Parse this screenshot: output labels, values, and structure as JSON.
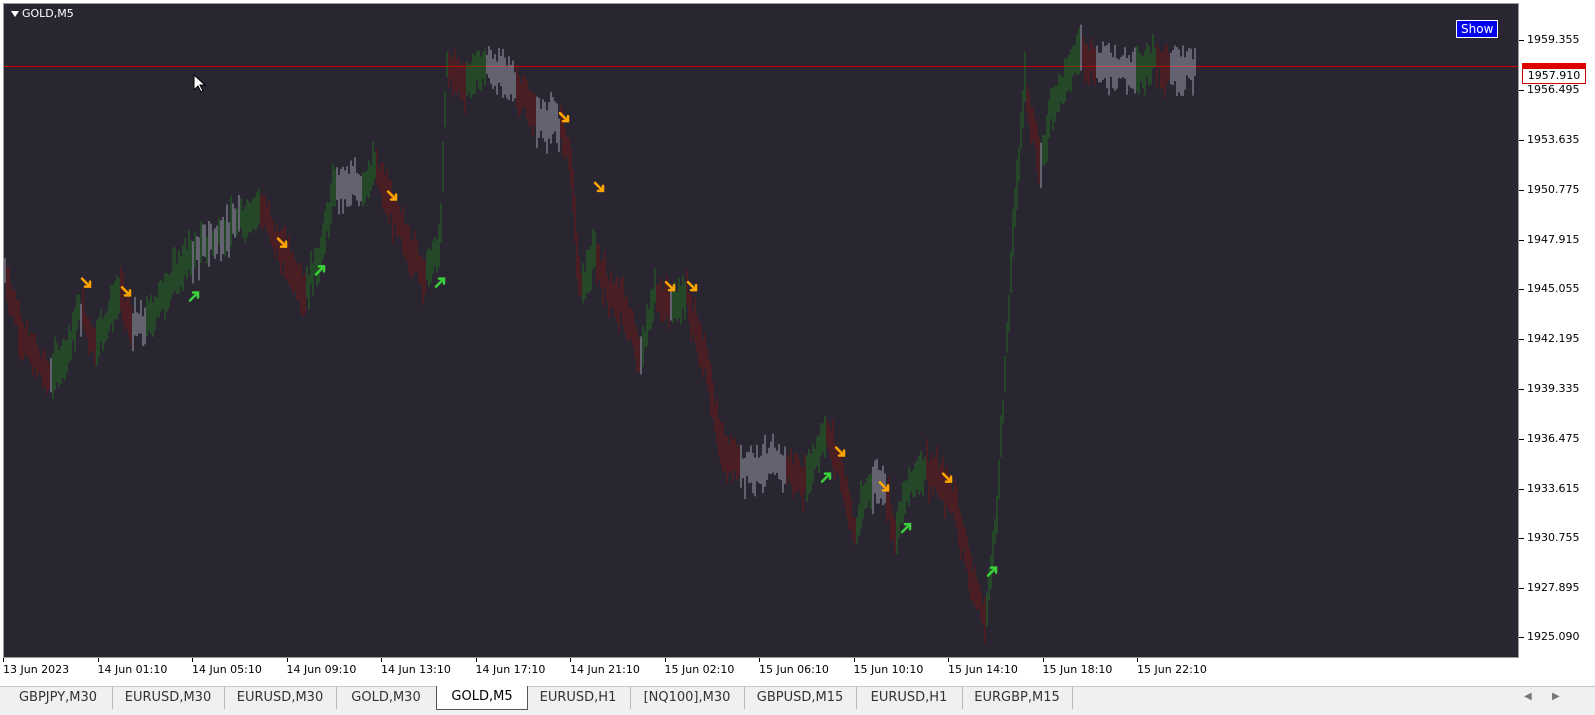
{
  "window": {
    "symbol_label": "GOLD,M5"
  },
  "show_button": {
    "label": "Show"
  },
  "current_price": "1957.910",
  "price_axis": [
    "1959.355",
    "1956.495",
    "1953.635",
    "1950.775",
    "1947.915",
    "1945.055",
    "1942.195",
    "1939.335",
    "1936.475",
    "1933.615",
    "1930.755",
    "1927.895",
    "1925.090"
  ],
  "time_axis": [
    "13 Jun 2023",
    "14 Jun 01:10",
    "14 Jun 05:10",
    "14 Jun 09:10",
    "14 Jun 13:10",
    "14 Jun 17:10",
    "14 Jun 21:10",
    "15 Jun 02:10",
    "15 Jun 06:10",
    "15 Jun 10:10",
    "15 Jun 14:10",
    "15 Jun 18:10",
    "15 Jun 22:10"
  ],
  "tabs": [
    {
      "label": "GBPJPY,M30"
    },
    {
      "label": "EURUSD,M30"
    },
    {
      "label": "EURUSD,M30"
    },
    {
      "label": "GOLD,M30"
    },
    {
      "label": "GOLD,M5",
      "active": true
    },
    {
      "label": "EURUSD,H1"
    },
    {
      "label": "[NQ100],M30"
    },
    {
      "label": "GBPUSD,M15"
    },
    {
      "label": "EURUSD,H1"
    },
    {
      "label": "EURGBP,M15"
    }
  ],
  "colors": {
    "background": "#2a2631",
    "bull": "#1f6b1f",
    "bear": "#6b1515",
    "neutral": "#9a9eb0",
    "arrow_up": "#3ccf3c",
    "arrow_down": "#ffa500",
    "hline": "#d00000"
  },
  "chart_data": {
    "type": "bar",
    "title": "GOLD,M5",
    "ylim": [
      1924,
      1961.5
    ],
    "hline": 1957.91,
    "path": [
      [
        0,
        1946
      ],
      [
        20,
        1942
      ],
      [
        45,
        1940
      ],
      [
        65,
        1942
      ],
      [
        75,
        1944
      ],
      [
        90,
        1942
      ],
      [
        115,
        1945
      ],
      [
        125,
        1943
      ],
      [
        140,
        1943
      ],
      [
        160,
        1945
      ],
      [
        185,
        1947
      ],
      [
        210,
        1948
      ],
      [
        235,
        1949
      ],
      [
        255,
        1950
      ],
      [
        270,
        1948
      ],
      [
        280,
        1947
      ],
      [
        300,
        1945
      ],
      [
        315,
        1947
      ],
      [
        330,
        1951
      ],
      [
        355,
        1951
      ],
      [
        370,
        1952
      ],
      [
        385,
        1950
      ],
      [
        400,
        1948
      ],
      [
        420,
        1946
      ],
      [
        435,
        1947.5
      ],
      [
        442,
        1958
      ],
      [
        460,
        1957
      ],
      [
        480,
        1958
      ],
      [
        510,
        1957
      ],
      [
        530,
        1955
      ],
      [
        555,
        1954.5
      ],
      [
        565,
        1953
      ],
      [
        575,
        1945
      ],
      [
        590,
        1947
      ],
      [
        605,
        1945
      ],
      [
        620,
        1944
      ],
      [
        635,
        1941
      ],
      [
        650,
        1945
      ],
      [
        665,
        1944
      ],
      [
        680,
        1945
      ],
      [
        690,
        1943
      ],
      [
        705,
        1940
      ],
      [
        715,
        1936
      ],
      [
        735,
        1935
      ],
      [
        760,
        1935
      ],
      [
        780,
        1935
      ],
      [
        800,
        1934
      ],
      [
        820,
        1937
      ],
      [
        835,
        1935
      ],
      [
        850,
        1931
      ],
      [
        865,
        1934
      ],
      [
        880,
        1934
      ],
      [
        890,
        1931
      ],
      [
        905,
        1934
      ],
      [
        920,
        1935
      ],
      [
        935,
        1934
      ],
      [
        950,
        1933
      ],
      [
        965,
        1929
      ],
      [
        980,
        1926
      ],
      [
        990,
        1931
      ],
      [
        1000,
        1940
      ],
      [
        1010,
        1950
      ],
      [
        1020,
        1957
      ],
      [
        1035,
        1952
      ],
      [
        1048,
        1956
      ],
      [
        1060,
        1957
      ],
      [
        1075,
        1959
      ],
      [
        1090,
        1958
      ],
      [
        1110,
        1958
      ],
      [
        1130,
        1957.5
      ],
      [
        1150,
        1958.5
      ],
      [
        1165,
        1957.8
      ],
      [
        1190,
        1957.9
      ]
    ],
    "markers": [
      {
        "x": 82,
        "price": 1945.5,
        "dir": "down"
      },
      {
        "x": 122,
        "price": 1945,
        "dir": "down"
      },
      {
        "x": 190,
        "price": 1944.7,
        "dir": "up"
      },
      {
        "x": 278,
        "price": 1947.8,
        "dir": "down"
      },
      {
        "x": 316,
        "price": 1946.2,
        "dir": "up"
      },
      {
        "x": 388,
        "price": 1950.5,
        "dir": "down"
      },
      {
        "x": 436,
        "price": 1945.5,
        "dir": "up"
      },
      {
        "x": 560,
        "price": 1955,
        "dir": "down"
      },
      {
        "x": 595,
        "price": 1951,
        "dir": "down"
      },
      {
        "x": 666,
        "price": 1945.3,
        "dir": "down"
      },
      {
        "x": 688,
        "price": 1945.3,
        "dir": "down"
      },
      {
        "x": 822,
        "price": 1934.3,
        "dir": "up"
      },
      {
        "x": 836,
        "price": 1935.8,
        "dir": "down"
      },
      {
        "x": 880,
        "price": 1933.8,
        "dir": "down"
      },
      {
        "x": 902,
        "price": 1931.4,
        "dir": "up"
      },
      {
        "x": 943,
        "price": 1934.3,
        "dir": "down"
      },
      {
        "x": 988,
        "price": 1928.9,
        "dir": "up"
      }
    ]
  }
}
